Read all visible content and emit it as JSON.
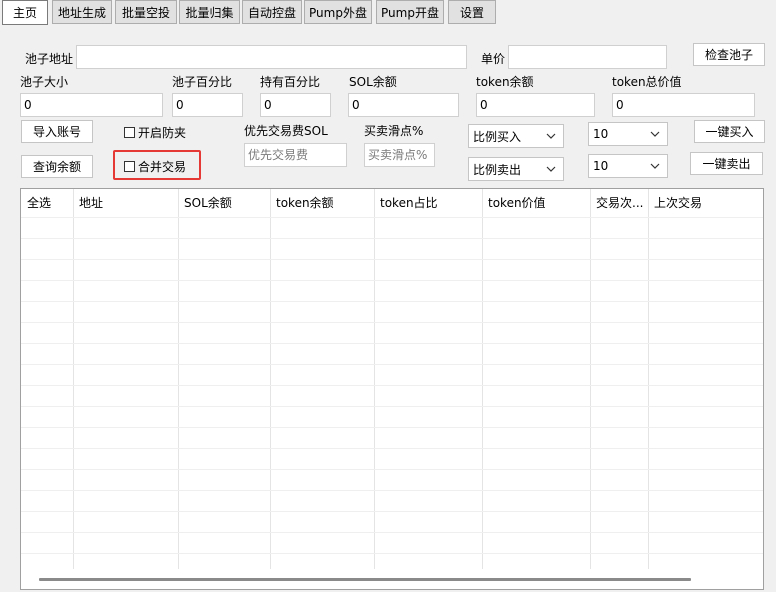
{
  "tabs": [
    {
      "label": "主页",
      "active": true
    },
    {
      "label": "地址生成",
      "active": false
    },
    {
      "label": "批量空投",
      "active": false
    },
    {
      "label": "批量归集",
      "active": false
    },
    {
      "label": "自动控盘",
      "active": false
    },
    {
      "label": "Pump外盘",
      "active": false
    },
    {
      "label": "Pump开盘",
      "active": false
    },
    {
      "label": "设置",
      "active": false
    }
  ],
  "form": {
    "pool_address_label": "池子地址",
    "pool_address_value": "",
    "unit_price_label": "单价",
    "unit_price_value": "",
    "check_pool_button": "检查池子",
    "pool_size_label": "池子大小",
    "pool_size_value": "0",
    "pool_percent_label": "池子百分比",
    "pool_percent_value": "0",
    "hold_percent_label": "持有百分比",
    "hold_percent_value": "0",
    "sol_balance_label": "SOL余额",
    "sol_balance_value": "0",
    "token_balance_label": "token余额",
    "token_balance_value": "0",
    "token_total_label": "token总价值",
    "token_total_value": "0",
    "import_account_button": "导入账号",
    "query_balance_button": "查询余额",
    "anti_sandwich_label": "开启防夹",
    "merge_trade_label": "合并交易",
    "priority_fee_label": "优先交易费SOL",
    "priority_fee_placeholder": "优先交易费",
    "slippage_label": "买卖滑点%",
    "slippage_placeholder": "买卖滑点%",
    "buy_mode_value": "比例买入",
    "sell_mode_value": "比例卖出",
    "buy_amount_value": "10",
    "sell_amount_value": "10",
    "one_click_buy_button": "一键买入",
    "one_click_sell_button": "一键卖出"
  },
  "table": {
    "columns": [
      "全选",
      "地址",
      "SOL余额",
      "token余额",
      "token占比",
      "token价值",
      "交易次...",
      "上次交易"
    ],
    "rows": []
  },
  "colors": {
    "highlight": "#e53935"
  }
}
